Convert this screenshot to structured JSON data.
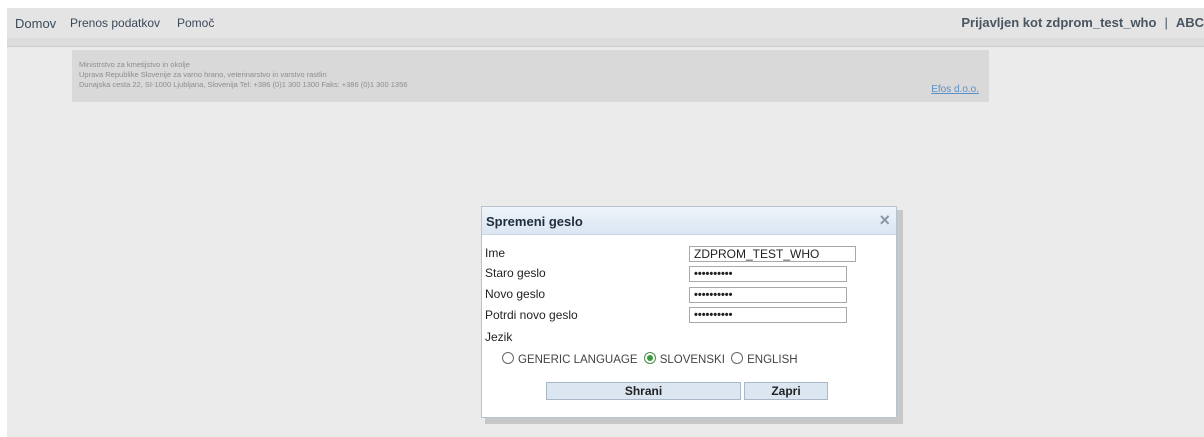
{
  "nav": {
    "home": "Domov",
    "transfer": "Prenos podatkov",
    "help": "Pomoč"
  },
  "user": {
    "logged_in_as": "Prijavljen kot zdprom_test_who",
    "separator": "|",
    "extra": "ABC"
  },
  "info": {
    "line1": "Ministrstvo za kmetijstvo in okolje",
    "line2": "Uprava Republike Slovenije za varno hrano, veterinarstvo in varstvo rastlin",
    "line3": "Dunajska cesta 22, SI-1000 Ljubljana, Slovenija Tel: +386 (0)1 300 1300 Faks: +386 (0)1 300 1356",
    "vendor_link": "Efos d.o.o."
  },
  "dialog": {
    "title": "Spremeni geslo",
    "close_icon": "×",
    "fields": {
      "name_label": "Ime",
      "name_value": "ZDPROM_TEST_WHO",
      "old_password_label": "Staro geslo",
      "old_password_value": "••••••••••",
      "new_password_label": "Novo geslo",
      "new_password_value": "••••••••••",
      "confirm_password_label": "Potrdi novo geslo",
      "confirm_password_value": "••••••••••"
    },
    "language": {
      "label": "Jezik",
      "options": [
        "GENERIC LANGUAGE",
        "SLOVENSKI",
        "ENGLISH"
      ],
      "selected": "SLOVENSKI"
    },
    "buttons": {
      "save": "Shrani",
      "close": "Zapri"
    }
  }
}
